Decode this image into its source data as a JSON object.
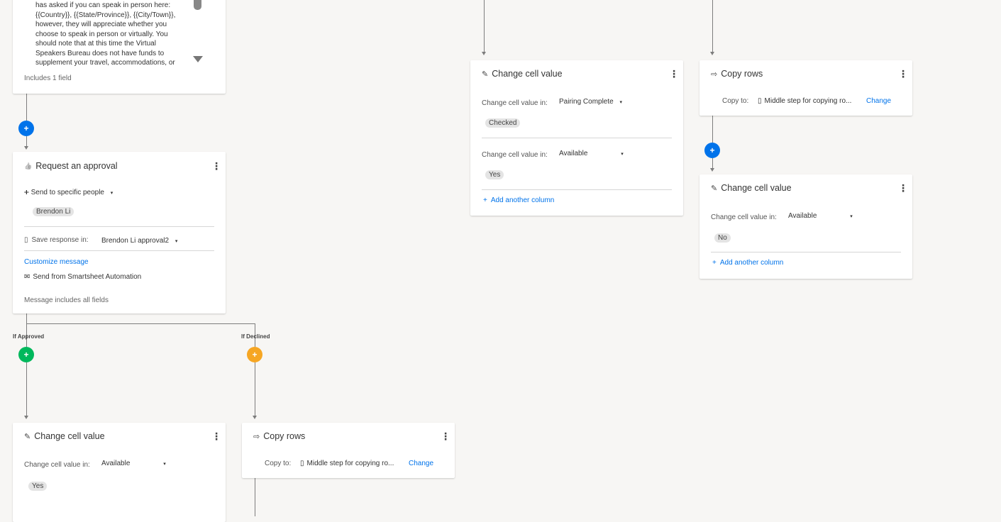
{
  "message_card": {
    "text_lines": [
      "has asked if you can speak in person here:",
      "{{Country}}, {{State/Province}}, {{City/Town}},",
      "however, they will appreciate whether you",
      "choose to speak in person or virtually. You",
      "should note that at this time the Virtual",
      "Speakers Bureau does not have funds to",
      "supplement your travel, accommodations, or"
    ],
    "includes": "Includes 1 field"
  },
  "approval_card": {
    "title": "Request an approval",
    "send_to": "Send to specific people",
    "recipient": "Brendon Li",
    "save_label": "Save response in:",
    "save_value": "Brendon Li approval2",
    "customize": "Customize message",
    "send_from": "Send from Smartsheet Automation",
    "message_includes": "Message includes all fields"
  },
  "branches": {
    "approved": "If Approved",
    "declined": "If Declined"
  },
  "approved_change_card": {
    "title": "Change cell value",
    "label": "Change cell value in:",
    "column": "Available",
    "value": "Yes"
  },
  "declined_copy_card": {
    "title": "Copy rows",
    "copy_to": "Copy to:",
    "sheet": "Middle step for copying ro...",
    "change": "Change"
  },
  "middle_change_card": {
    "title": "Change cell value",
    "rows": [
      {
        "label": "Change cell value in:",
        "column": "Pairing Complete",
        "value": "Checked"
      },
      {
        "label": "Change cell value in:",
        "column": "Available",
        "value": "Yes"
      }
    ],
    "add_column": "Add another column"
  },
  "right_copy_card": {
    "title": "Copy rows",
    "copy_to": "Copy to:",
    "sheet": "Middle step for copying ro...",
    "change": "Change"
  },
  "right_change_card": {
    "title": "Change cell value",
    "label": "Change cell value in:",
    "column": "Available",
    "value": "No",
    "add_column": "Add another column"
  },
  "icons": {
    "pencil": "✎",
    "copy": "⇨",
    "thumb": "👍",
    "person_add": "+👤",
    "save": "▯",
    "mail": "✉",
    "sheet": "▯",
    "kebab": "⋮",
    "plus": "+",
    "caret": "▾"
  }
}
